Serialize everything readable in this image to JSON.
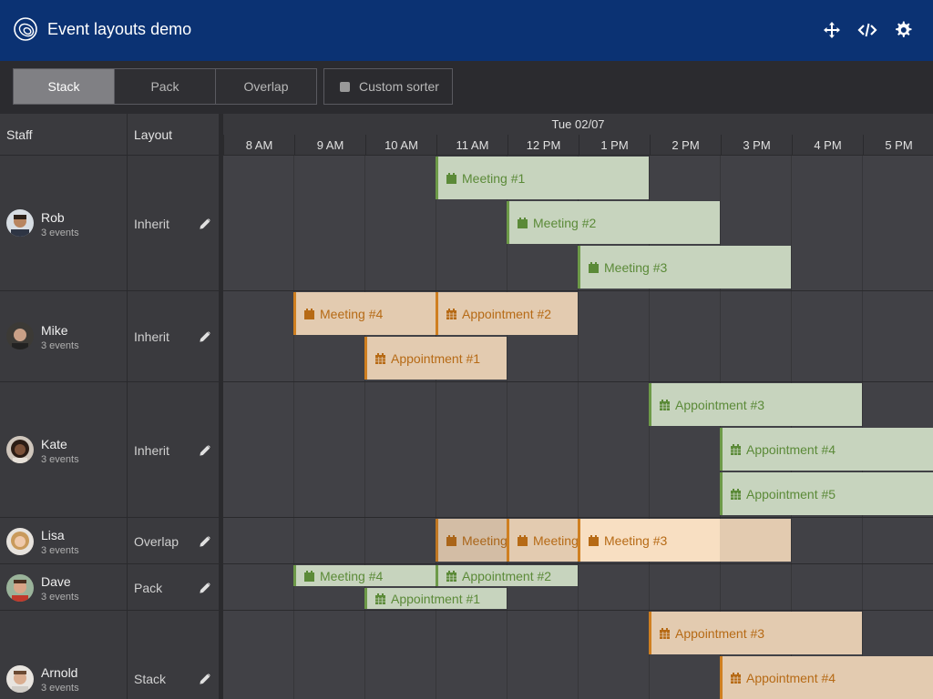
{
  "header": {
    "title": "Event layouts demo",
    "logo_icon": "bryntum-logo-icon",
    "buttons": [
      {
        "name": "move-icon"
      },
      {
        "name": "code-icon"
      },
      {
        "name": "gear-icon"
      }
    ]
  },
  "toolbar": {
    "layout_buttons": [
      "Stack",
      "Pack",
      "Overlap"
    ],
    "active_layout": "Stack",
    "custom_sorter_label": "Custom sorter",
    "custom_sorter_checked": false
  },
  "grid": {
    "col_staff": "Staff",
    "col_layout": "Layout",
    "date_header": "Tue 02/07",
    "hours": [
      "8 AM",
      "9 AM",
      "10 AM",
      "11 AM",
      "12 PM",
      "1 PM",
      "2 PM",
      "3 PM",
      "4 PM",
      "5 PM"
    ]
  },
  "resources": [
    {
      "name": "Rob",
      "count": "3 events",
      "layout": "Inherit"
    },
    {
      "name": "Mike",
      "count": "3 events",
      "layout": "Inherit"
    },
    {
      "name": "Kate",
      "count": "3 events",
      "layout": "Inherit"
    },
    {
      "name": "Lisa",
      "count": "3 events",
      "layout": "Overlap"
    },
    {
      "name": "Dave",
      "count": "3 events",
      "layout": "Pack"
    },
    {
      "name": "Arnold",
      "count": "3 events",
      "layout": "Stack"
    }
  ],
  "events": [
    {
      "name": "Meeting #1",
      "color": "green"
    },
    {
      "name": "Meeting #2",
      "color": "green"
    },
    {
      "name": "Meeting #3",
      "color": "green"
    },
    {
      "name": "Meeting #4",
      "color": "orange"
    },
    {
      "name": "Appointment #2",
      "color": "orange"
    },
    {
      "name": "Appointment #1",
      "color": "orange"
    },
    {
      "name": "Appointment #3",
      "color": "green"
    },
    {
      "name": "Appointment #4",
      "color": "green"
    },
    {
      "name": "Appointment #5",
      "color": "green"
    },
    {
      "name": "Meeting #1",
      "color": "orange"
    },
    {
      "name": "Meeting #2",
      "color": "orange"
    },
    {
      "name": "Meeting #3",
      "color": "orange"
    },
    {
      "name": "Meeting #4",
      "color": "green"
    },
    {
      "name": "Appointment #2",
      "color": "green"
    },
    {
      "name": "Appointment #1",
      "color": "green"
    },
    {
      "name": "Appointment #3",
      "color": "orange"
    },
    {
      "name": "Appointment #4",
      "color": "orange"
    }
  ],
  "colors": {
    "header_bg": "#0b3273",
    "green_bg": "#c7d4be",
    "green_text": "#5b8a38",
    "orange_bg": "#e3cbb0",
    "orange_text": "#b66a15"
  }
}
